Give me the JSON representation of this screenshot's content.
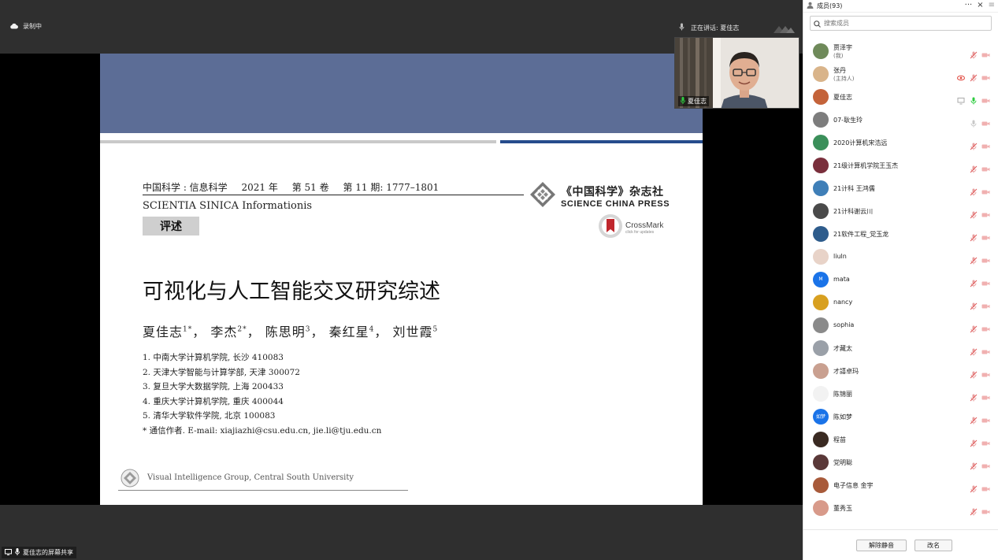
{
  "recording": {
    "label": "录制中"
  },
  "speaking": {
    "label": "正在讲话: 夏佳志"
  },
  "video": {
    "name": "夏佳志"
  },
  "share": {
    "label": "夏佳志的屏幕共享"
  },
  "slide": {
    "journal_line": [
      "中国科学 : 信息科学",
      "2021 年",
      "第 51 卷",
      "第 11 期: 1777–1801"
    ],
    "journal_en": "SCIENTIA SINICA  Informationis",
    "badge": "评述",
    "publisher_cn": "《中国科学》杂志社",
    "publisher_en": "SCIENCE CHINA PRESS",
    "crossmark": "CrossMark",
    "crossmark_sub": "click for updates",
    "title": "可视化与人工智能交叉研究综述",
    "authors": [
      {
        "name": "夏佳志",
        "sup": "1*"
      },
      {
        "name": "李杰",
        "sup": "2*"
      },
      {
        "name": "陈思明",
        "sup": "3"
      },
      {
        "name": "秦红星",
        "sup": "4"
      },
      {
        "name": "刘世霞",
        "sup": "5"
      }
    ],
    "affiliations": [
      "1. 中南大学计算机学院, 长沙 410083",
      "2. 天津大学智能与计算学部, 天津 300072",
      "3. 复旦大学大数据学院, 上海 200433",
      "4. 重庆大学计算机学院, 重庆 400044",
      "5. 清华大学软件学院, 北京 100083",
      "* 通信作者. E-mail: xiajiazhi@csu.edu.cn, jie.li@tju.edu.cn"
    ],
    "footer": "Visual Intelligence Group, Central South University"
  },
  "panel": {
    "title": "成员(93)",
    "more": "···",
    "close": "×",
    "menu": "≡",
    "search_placeholder": "搜索成员",
    "members": [
      {
        "name": "贾泽宇",
        "role": "(我)",
        "color": "#6f8a5a",
        "mic": "muted",
        "extra": ""
      },
      {
        "name": "张丹",
        "role": "(主持人)",
        "color": "#d9b48a",
        "mic": "muted",
        "extra": "record"
      },
      {
        "name": "夏佳志",
        "role": "",
        "color": "#c4633a",
        "mic": "active",
        "extra": "screen"
      },
      {
        "name": "07-耿生玲",
        "role": "",
        "color": "#7d7d7d",
        "mic": "gray",
        "extra": ""
      },
      {
        "name": "2020计算机宋浩远",
        "role": "",
        "color": "#3b8f5a",
        "mic": "muted",
        "extra": ""
      },
      {
        "name": "21级计算机学院王玉杰",
        "role": "",
        "color": "#7a2f3c",
        "mic": "muted",
        "extra": ""
      },
      {
        "name": "21计科 王鸿儒",
        "role": "",
        "color": "#3f7fb8",
        "mic": "muted",
        "extra": ""
      },
      {
        "name": "21计科谢云川",
        "role": "",
        "color": "#4a4a4a",
        "mic": "muted",
        "extra": ""
      },
      {
        "name": "21软件工程_党玉龙",
        "role": "",
        "color": "#2e5c8c",
        "mic": "muted",
        "extra": ""
      },
      {
        "name": "liuln",
        "role": "",
        "color": "#e8d3c8",
        "mic": "muted",
        "extra": ""
      },
      {
        "name": "mata",
        "role": "",
        "color": "#1a73e8",
        "mic": "muted",
        "extra": "",
        "initial": "M"
      },
      {
        "name": "nancy",
        "role": "",
        "color": "#d8a020",
        "mic": "muted",
        "extra": ""
      },
      {
        "name": "sophia",
        "role": "",
        "color": "#8a8a8a",
        "mic": "muted",
        "extra": ""
      },
      {
        "name": "才藏太",
        "role": "",
        "color": "#9aa0a8",
        "mic": "muted",
        "extra": ""
      },
      {
        "name": "才譆卓玛",
        "role": "",
        "color": "#c9a090",
        "mic": "muted",
        "extra": ""
      },
      {
        "name": "陈锦丽",
        "role": "",
        "color": "#f2f2f2",
        "mic": "muted",
        "extra": ""
      },
      {
        "name": "陈如梦",
        "role": "",
        "color": "#1a73e8",
        "mic": "muted",
        "extra": "",
        "initial": "如梦"
      },
      {
        "name": "程苗",
        "role": "",
        "color": "#3a2a22",
        "mic": "muted",
        "extra": ""
      },
      {
        "name": "党明聪",
        "role": "",
        "color": "#5a3838",
        "mic": "muted",
        "extra": ""
      },
      {
        "name": "电子信息 金宇",
        "role": "",
        "color": "#a85a3a",
        "mic": "muted",
        "extra": ""
      },
      {
        "name": "董秀玉",
        "role": "",
        "color": "#d89a8a",
        "mic": "muted",
        "extra": ""
      }
    ],
    "unmute_label": "解除静音",
    "rename_label": "改名"
  }
}
